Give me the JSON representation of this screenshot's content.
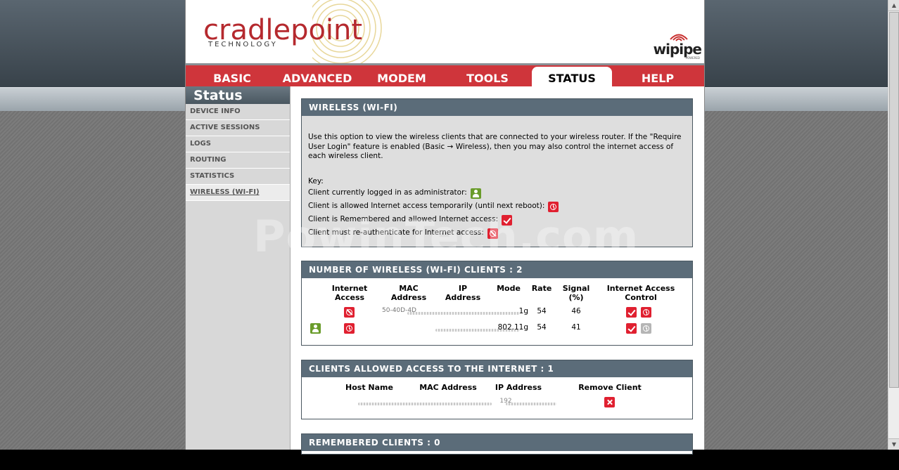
{
  "brand": {
    "name": "cradlepoint",
    "subtitle": "TECHNOLOGY",
    "product": "wipipe",
    "product_sub": "POWERED"
  },
  "nav": {
    "tabs": [
      {
        "label": "BASIC"
      },
      {
        "label": "ADVANCED"
      },
      {
        "label": "MODEM"
      },
      {
        "label": "TOOLS"
      },
      {
        "label": "STATUS",
        "active": true
      },
      {
        "label": "HELP"
      }
    ]
  },
  "sidebar": {
    "title": "Status",
    "items": [
      {
        "label": "DEVICE INFO"
      },
      {
        "label": "ACTIVE SESSIONS"
      },
      {
        "label": "LOGS"
      },
      {
        "label": "ROUTING"
      },
      {
        "label": "STATISTICS"
      },
      {
        "label": "WIRELESS (WI-FI)",
        "active": true
      }
    ]
  },
  "wireless": {
    "title": "WIRELESS (WI-FI)",
    "description": "Use this option to view the wireless clients that are connected to your wireless router. If the \"Require User Login\" feature is enabled (Basic → Wireless), then you may also control the internet access of each wireless client.",
    "key_label": "Key:",
    "key": [
      {
        "text": "Client currently logged in as administrator:",
        "icon": "admin-user-icon"
      },
      {
        "text": "Client is allowed Internet access temporarily (until next reboot):",
        "icon": "clock-icon"
      },
      {
        "text": "Client is Remembered and allowed Internet access:",
        "icon": "checkmark-icon"
      },
      {
        "text": "Client must re-authenticate for Internet access:",
        "icon": "no-access-icon"
      }
    ]
  },
  "clients": {
    "title": "NUMBER OF WIRELESS (WI-FI) CLIENTS : 2",
    "headers": {
      "internet_access": "Internet Access",
      "mac": "MAC Address",
      "ip": "IP Address",
      "mode": "Mode",
      "rate": "Rate",
      "signal": "Signal (%)",
      "control": "Internet Access Control"
    },
    "rows": [
      {
        "mac_partial": "50-40D-4D",
        "mode": "1g",
        "rate": "54",
        "signal": "46"
      },
      {
        "mac_partial": "",
        "mode": "802.11g",
        "rate": "54",
        "signal": "41"
      }
    ]
  },
  "allowed": {
    "title": "CLIENTS ALLOWED ACCESS TO THE INTERNET : 1",
    "headers": {
      "host": "Host Name",
      "mac": "MAC Address",
      "ip": "IP Address",
      "remove": "Remove Client"
    },
    "ip_partial": "192"
  },
  "remembered": {
    "title": "REMEMBERED CLIENTS : 0"
  },
  "watermark": "PowinTech.com",
  "colors": {
    "nav_red": "#cf353b",
    "header_slate": "#5b6c79",
    "icon_red": "#e02030",
    "icon_green": "#6a9c2b",
    "logo_red": "#b5292e"
  }
}
